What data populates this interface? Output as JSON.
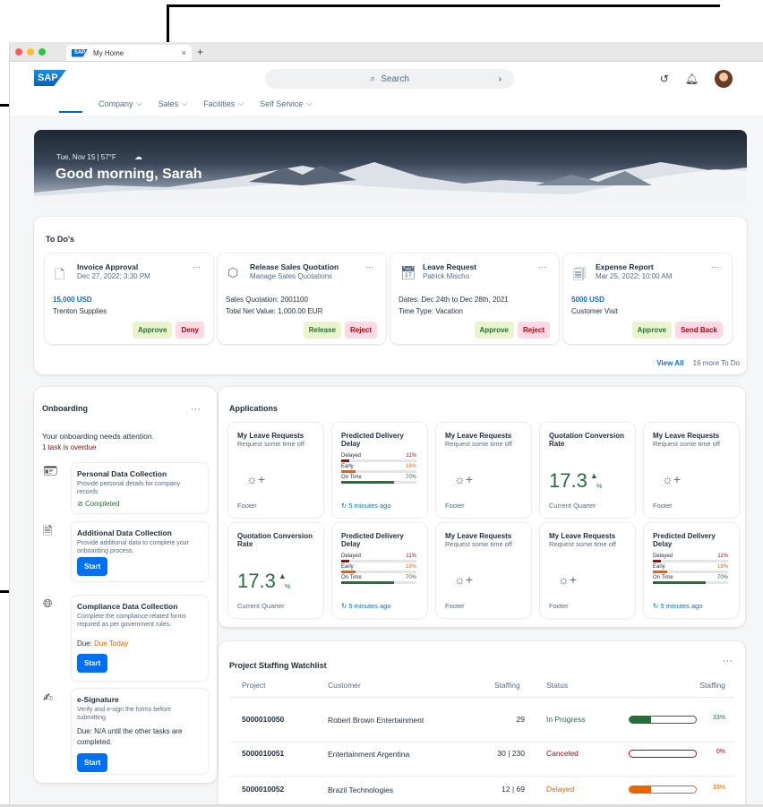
{
  "browser": {
    "tab_title": "My Home",
    "tab_close": "×",
    "new_tab": "+",
    "logo_text": "SAP"
  },
  "shell": {
    "logo": "SAP",
    "search_placeholder": "Search"
  },
  "menu": [
    {
      "label": "Company"
    },
    {
      "label": "Sales"
    },
    {
      "label": "Facilities"
    },
    {
      "label": "Self Service"
    }
  ],
  "hero": {
    "date": "Tue, Nov 15 | 57°F",
    "greeting": "Good morning, Sarah"
  },
  "todos": {
    "title": "To Do's",
    "items": [
      {
        "title": "Invoice Approval",
        "subtitle": "Dec 27, 2022; 3:30 PM",
        "line1": "15,000 USD",
        "line2": "Trenton Supplies",
        "pos_btn": "Approve",
        "neg_btn": "Deny",
        "more": "···"
      },
      {
        "title": "Release Sales Quotation",
        "subtitle": "Manage Sales Quotations",
        "line1": "Sales Quotation: 2001100",
        "line2": "Total Net Value: 1,000.00 EUR",
        "pos_btn": "Release",
        "neg_btn": "Reject",
        "more": "···"
      },
      {
        "title": "Leave Request",
        "subtitle": "Patrick Mischo",
        "line1": "Dates: Dec 24th to Dec 28th, 2021",
        "line2": "Time Type: Vacation",
        "pos_btn": "Approve",
        "neg_btn": "Reject",
        "more": "···"
      },
      {
        "title": "Expense Report",
        "subtitle": "Mar 25, 2022; 10:00 AM",
        "line1": "5000 USD",
        "line2": "Customer Visit",
        "pos_btn": "Approve",
        "neg_btn": "Send Back",
        "more": "···"
      }
    ],
    "view_all": "View All",
    "more_count": "16 more To Do"
  },
  "onboarding": {
    "title": "Onboarding",
    "more": "···",
    "attention": "Your onboarding needs attention.",
    "overdue": "1 task is overdue",
    "tasks": [
      {
        "title": "Personal Data Collection",
        "desc": "Provide personal details for company records",
        "status": "Completed"
      },
      {
        "title": "Additional Data Collection",
        "desc": "Provide additional data to complete your onboarding process.",
        "button": "Start"
      },
      {
        "title": "Compliance Data Collection",
        "desc": "Complete the compliance related forms required as per government rules.",
        "due_label": "Due:",
        "due_value": "Due Today",
        "button": "Start"
      },
      {
        "title": "e-Signature",
        "desc": "Verify and e-sign the forms before submitting.",
        "due_text": "Due: N/A until the other tasks are completed.",
        "button": "Start"
      }
    ]
  },
  "applications": {
    "title": "Applications",
    "tiles": [
      {
        "kind": "launch",
        "title": "My Leave Requests",
        "subtitle": "Request some time off",
        "footer": "Footer"
      },
      {
        "kind": "bars",
        "title": "Predicted Delivery Delay",
        "footer": "5 minutes ago"
      },
      {
        "kind": "launch",
        "title": "My Leave Requests",
        "subtitle": "Request some time off",
        "footer": "Footer"
      },
      {
        "kind": "kpi",
        "title": "Quotation Conversion Rate",
        "value": "17.3",
        "unit": "%",
        "footer": "Current Quarter"
      },
      {
        "kind": "launch",
        "title": "My Leave Requests",
        "subtitle": "Request some time off",
        "footer": "Footer"
      },
      {
        "kind": "kpi",
        "title": "Quotation Conversion Rate",
        "value": "17.3",
        "unit": "%",
        "footer": "Current Quarter"
      },
      {
        "kind": "bars",
        "title": "Predicted Delivery Delay",
        "footer": "5 minutes ago"
      },
      {
        "kind": "launch",
        "title": "My Leave Requests",
        "subtitle": "Request some time off",
        "footer": "Footer"
      },
      {
        "kind": "launch",
        "title": "My Leave Requests",
        "subtitle": "Request some time off",
        "footer": "Footer"
      },
      {
        "kind": "bars",
        "title": "Predicted Delivery Delay",
        "footer": "5 minutes ago"
      }
    ],
    "bars": [
      {
        "label": "Delayed",
        "value": "11%",
        "fraction": 0.11,
        "color": "#aa0808"
      },
      {
        "label": "Early",
        "value": "19%",
        "fraction": 0.19,
        "color": "#e76500"
      },
      {
        "label": "On Time",
        "value": "70%",
        "fraction": 0.7,
        "color": "#256f3a"
      }
    ]
  },
  "staffing": {
    "title": "Project Staffing Watchlist",
    "more": "···",
    "headers": [
      "Project",
      "Customer",
      "Staffing",
      "Status",
      "Staffing"
    ],
    "rows": [
      {
        "project": "5000010050",
        "customer": "Robert Brown Entertainment",
        "staffing": "29",
        "status": "In Progress",
        "status_color": "#256f3a",
        "progress": 0.33,
        "progress_label": "33%"
      },
      {
        "project": "5000010051",
        "customer": "Entertainment Argentina",
        "staffing": "30 | 230",
        "status": "Canceled",
        "status_color": "#aa0808",
        "progress": 0,
        "progress_label": "0%"
      },
      {
        "project": "5000010052",
        "customer": "Brazil Technologies",
        "staffing": "12 | 69",
        "status": "Delayed",
        "status_color": "#e76500",
        "progress": 0.33,
        "progress_label": "33%"
      }
    ]
  },
  "colors": {
    "accent": "#0070f2",
    "positive": "#256f3a",
    "negative": "#aa0808",
    "critical": "#e76500"
  }
}
